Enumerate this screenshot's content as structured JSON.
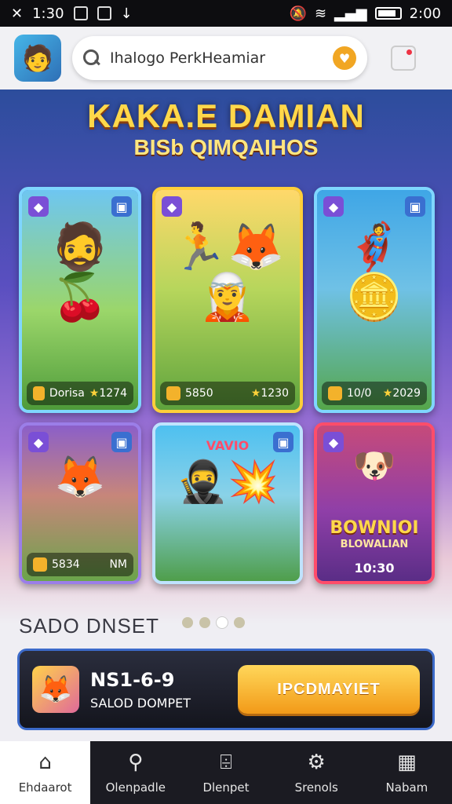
{
  "status_bar": {
    "left_time": "1:30",
    "right_time": "2:00"
  },
  "header": {
    "search_value": "Ihalogo PerkHeamiar",
    "avatar_icon": "hero-avatar-icon",
    "search_icon": "search-icon",
    "badge_icon": "coin-heart-icon",
    "notification_icon": "notification-icon"
  },
  "hero": {
    "title": "KAKA.E DAMIAN",
    "subtitle": "BISb QIMQAIHOS"
  },
  "cards": [
    {
      "footer_left": "Dorisa",
      "footer_right": "1274",
      "has_star": true
    },
    {
      "footer_left": "5850",
      "footer_right": "1230",
      "has_star": true
    },
    {
      "footer_left": "10/0",
      "footer_right": "2029",
      "has_star": true
    },
    {
      "footer_left": "5834",
      "footer_right": "NM",
      "has_star": false
    },
    {
      "footer_left": "",
      "footer_right": "",
      "overlay": "VAVIO",
      "has_star": false
    },
    {
      "footer_left": "",
      "footer_right": "",
      "overlay_title": "BOWNIOI",
      "overlay_sub": "BLOWALIAN",
      "time": "10:30",
      "has_star": false
    }
  ],
  "section": {
    "title": "SADO DNSET",
    "dots": 4,
    "active_dot": 2
  },
  "promo": {
    "code": "NS1-6-9",
    "subtitle": "SALOD DOMPET",
    "button_label": "IPCDMAYIET"
  },
  "bottom_nav": [
    {
      "label": "Ehdaarot",
      "icon": "home-icon",
      "active": true
    },
    {
      "label": "Olenpadle",
      "icon": "search-icon",
      "active": false
    },
    {
      "label": "Dlenpet",
      "icon": "tag-icon",
      "active": false
    },
    {
      "label": "Srenols",
      "icon": "settings-icon",
      "active": false
    },
    {
      "label": "Nabam",
      "icon": "calendar-icon",
      "active": false
    }
  ],
  "colors": {
    "accent_gold": "#f29a18",
    "card_border_blue": "#7fd6ff",
    "card_border_gold": "#ffcf3a",
    "card_border_red": "#ff4d6a"
  }
}
